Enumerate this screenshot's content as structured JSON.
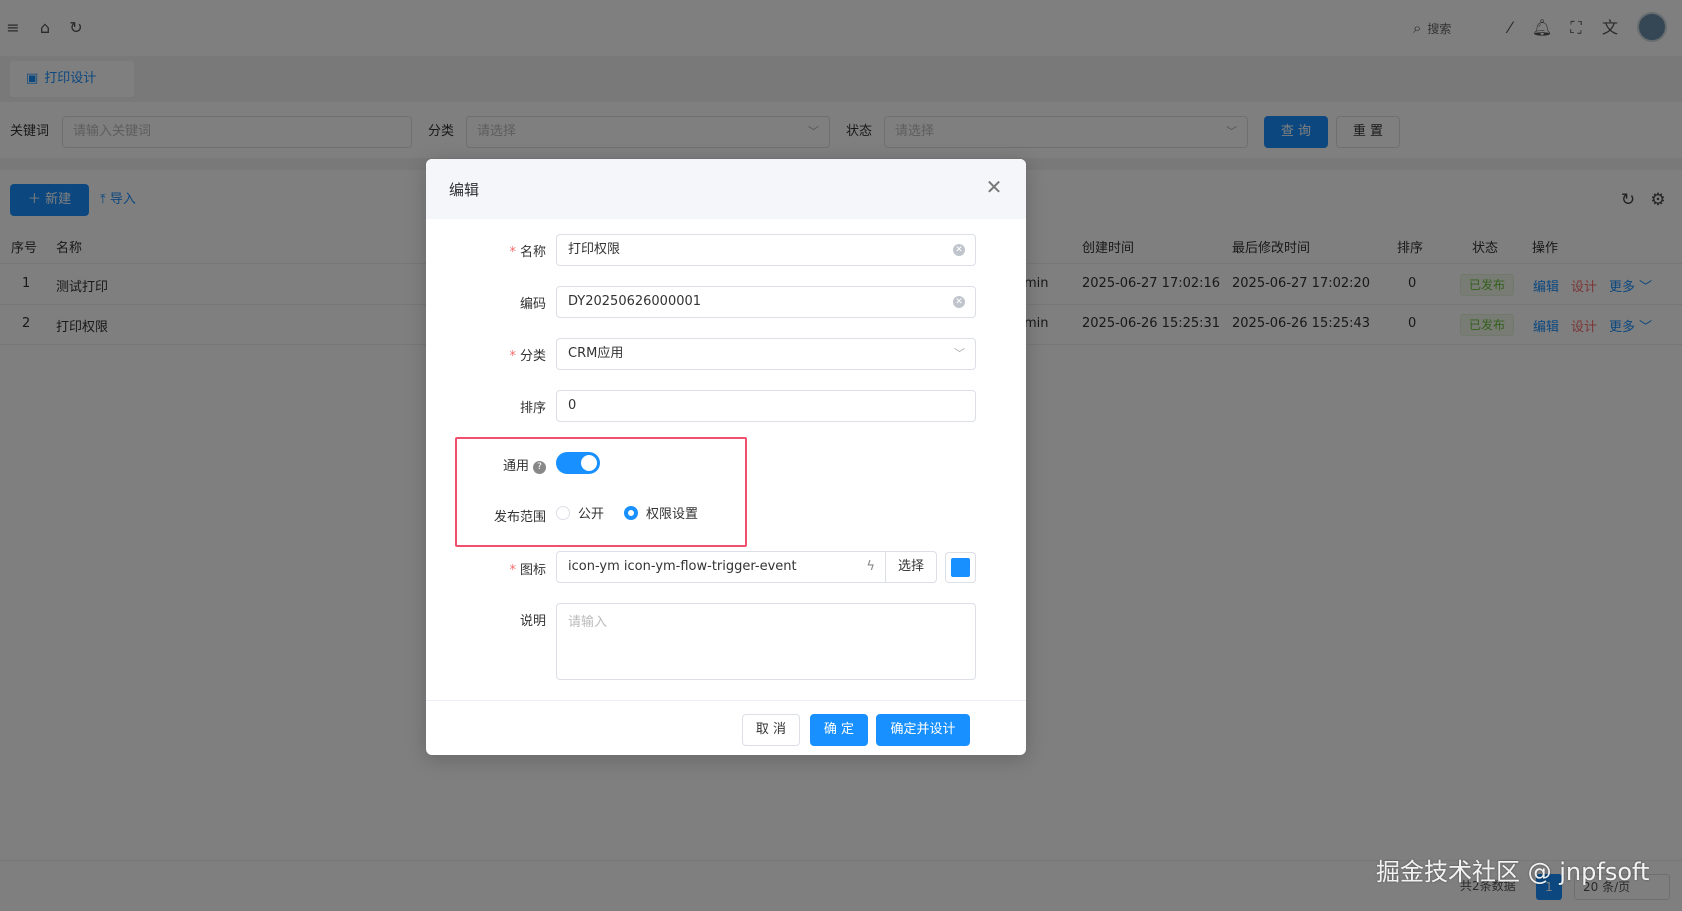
{
  "topbar": {
    "search_label": "搜索",
    "icons": [
      "menu-icon",
      "home-icon",
      "refresh-icon",
      "search-icon",
      "language-icon",
      "bell-icon",
      "fullscreen-icon",
      "translate-icon"
    ]
  },
  "tabs": [
    {
      "label": "打印设计"
    }
  ],
  "search": {
    "keyword_label": "关键词",
    "keyword_placeholder": "请输入关键词",
    "category_label": "分类",
    "category_placeholder": "请选择",
    "status_label": "状态",
    "status_placeholder": "请选择",
    "query_button": "查 询",
    "reset_button": "重 置"
  },
  "toolbar": {
    "new_button": "新建",
    "import_button": "导入"
  },
  "table": {
    "headers": {
      "index": "序号",
      "name": "名称",
      "created": "创建时间",
      "modified": "最后修改时间",
      "sort": "排序",
      "status": "状态",
      "actions": "操作"
    },
    "rows": [
      {
        "index": "1",
        "name": "测试打印",
        "creator_tail": "min",
        "created": "2025-06-27 17:02:16",
        "modified": "2025-06-27 17:02:20",
        "sort": "0",
        "status": "已发布",
        "edit": "编辑",
        "design": "设计",
        "more": "更多"
      },
      {
        "index": "2",
        "name": "打印权限",
        "creator_tail": "min",
        "created": "2025-06-26 15:25:31",
        "modified": "2025-06-26 15:25:43",
        "sort": "0",
        "status": "已发布",
        "edit": "编辑",
        "design": "设计",
        "more": "更多"
      }
    ]
  },
  "pagination": {
    "total": "共2条数据",
    "current": "1",
    "page_size": "20 条/页"
  },
  "dialog": {
    "title": "编辑",
    "fields": {
      "name_label": "名称",
      "name_value": "打印权限",
      "code_label": "编码",
      "code_value": "DY20250626000001",
      "category_label": "分类",
      "category_value": "CRM应用",
      "sort_label": "排序",
      "sort_value": "0",
      "common_label": "通用",
      "common_on": true,
      "scope_label": "发布范围",
      "scope_public": "公开",
      "scope_permission": "权限设置",
      "scope_selected": "权限设置",
      "icon_label": "图标",
      "icon_value": "icon-ym icon-ym-flow-trigger-event",
      "icon_select": "选择",
      "icon_color": "#1890ff",
      "desc_label": "说明",
      "desc_placeholder": "请输入"
    },
    "buttons": {
      "cancel": "取 消",
      "ok": "确 定",
      "ok_design": "确定并设计"
    }
  },
  "watermark": "掘金技术社区 @ jnpfsoft",
  "colors": {
    "primary": "#1890ff",
    "danger": "#f56c6c",
    "success": "#67c23a",
    "highlight": "#f0506e"
  }
}
